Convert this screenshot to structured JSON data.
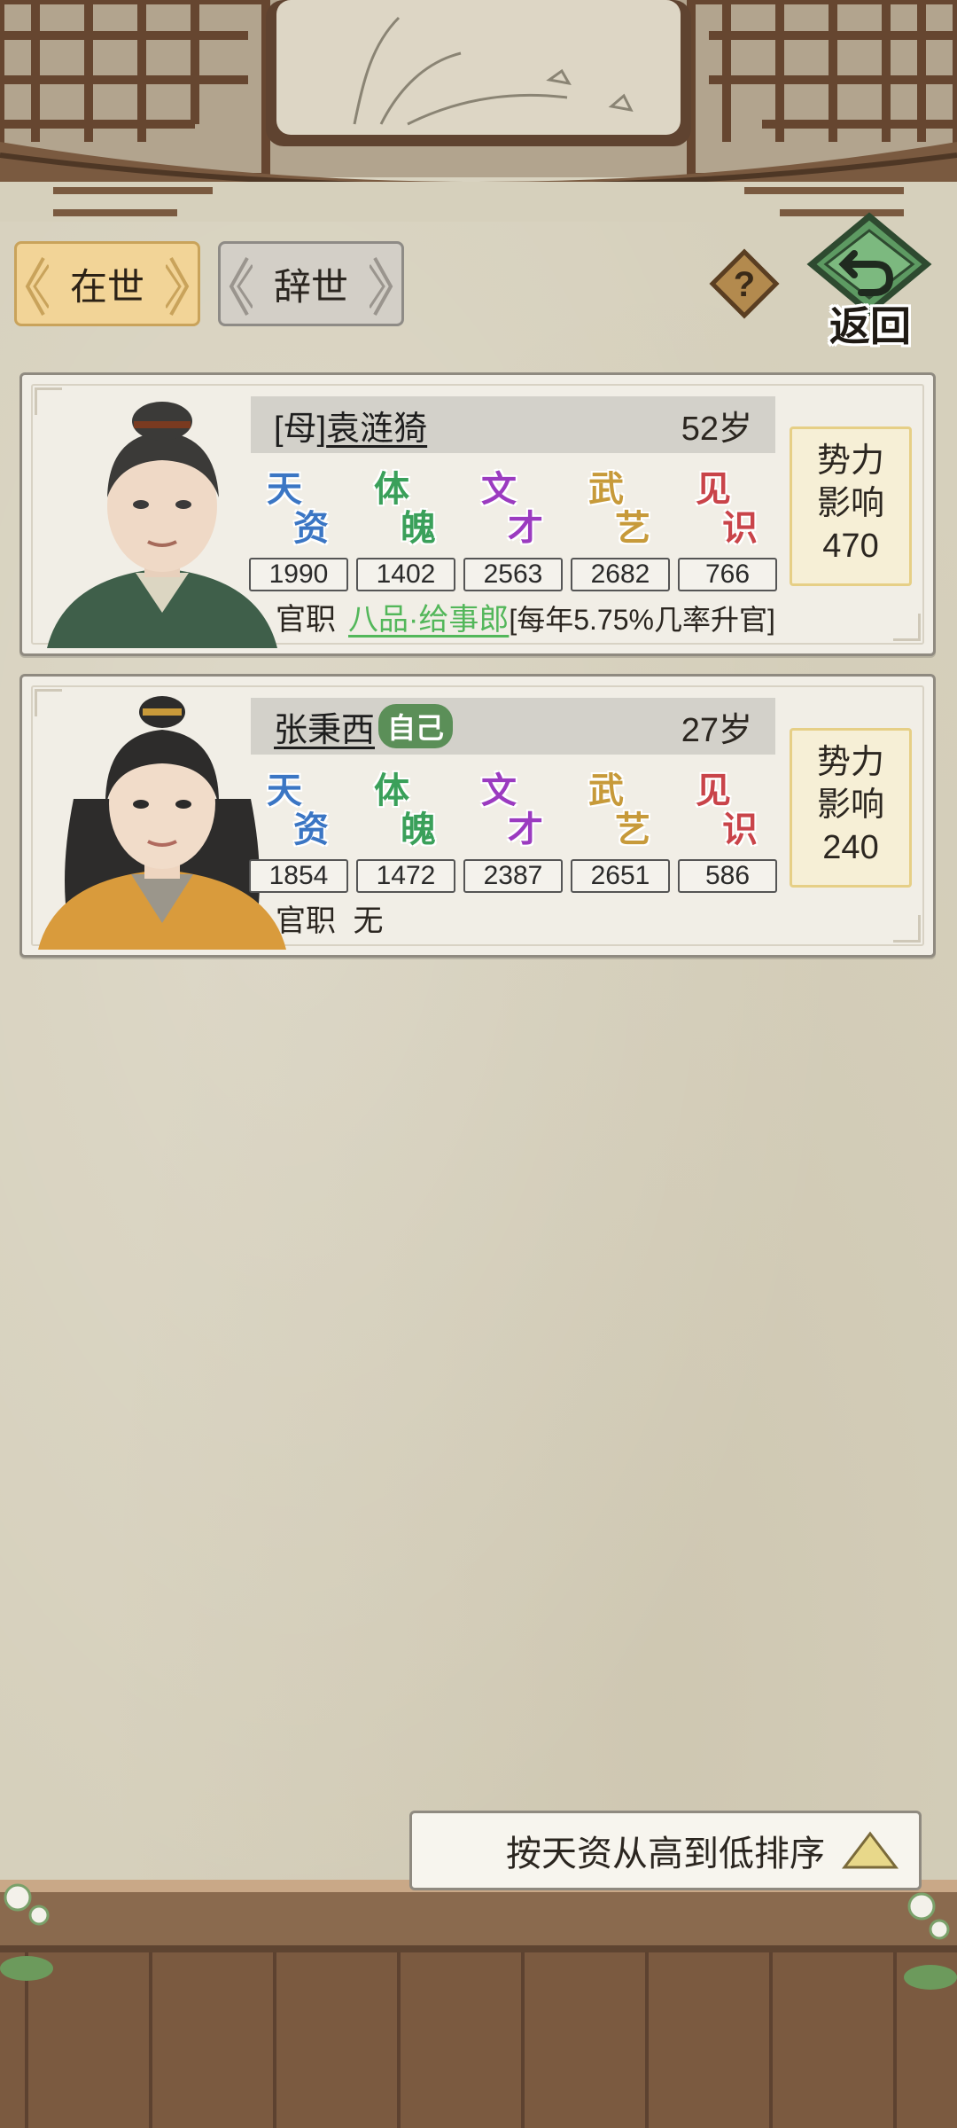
{
  "tabs": {
    "alive": "在世",
    "dead": "辞世"
  },
  "back_label": "返回",
  "stat_labels": [
    {
      "top": "天",
      "bottom": "资",
      "color": "#3b76c4"
    },
    {
      "top": "体",
      "bottom": "魄",
      "color": "#3aa05a"
    },
    {
      "top": "文",
      "bottom": "才",
      "color": "#9b3bc0"
    },
    {
      "top": "武",
      "bottom": "艺",
      "color": "#c79a3a"
    },
    {
      "top": "见",
      "bottom": "识",
      "color": "#c9444a"
    }
  ],
  "members": [
    {
      "relation": "[母]",
      "name": "袁涟猗",
      "age": "52岁",
      "stats": [
        "1990",
        "1402",
        "2563",
        "2682",
        "766"
      ],
      "influence_label_1": "势力",
      "influence_label_2": "影响",
      "influence": "470",
      "office_label": "官职",
      "office_rank": "八品·给事郎",
      "office_note": "[每年5.75%几率升官]"
    },
    {
      "relation": "",
      "name": "张秉西",
      "self_badge": "自己",
      "age": "27岁",
      "stats": [
        "1854",
        "1472",
        "2387",
        "2651",
        "586"
      ],
      "influence_label_1": "势力",
      "influence_label_2": "影响",
      "influence": "240",
      "office_label": "官职",
      "office_value": "无"
    }
  ],
  "sort": {
    "label": "按天资从高到低排序"
  },
  "colors": {
    "paper": "#d6d0bc",
    "wood": "#7a5a40",
    "tab_active": "#f2d497"
  }
}
